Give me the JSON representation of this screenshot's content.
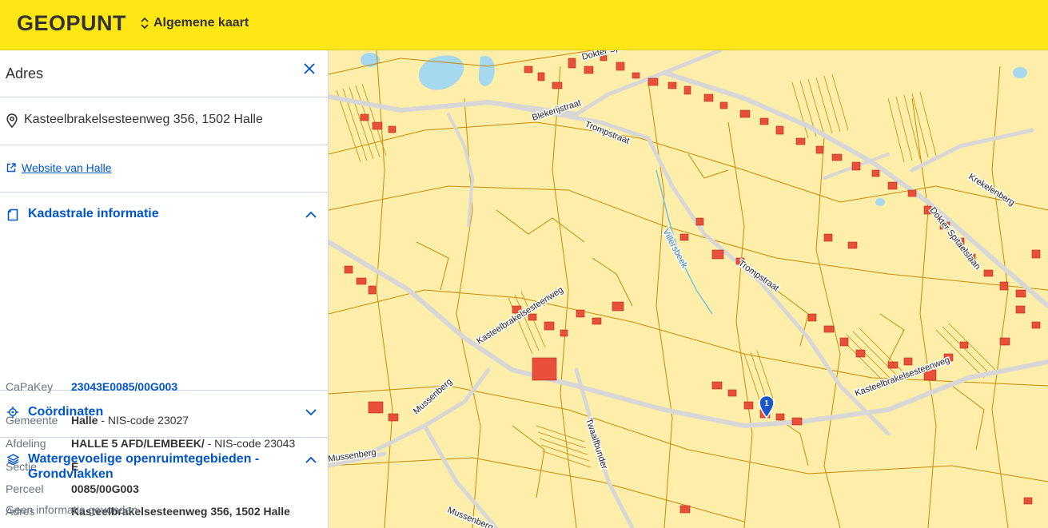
{
  "header": {
    "logo": "GEOPUNT",
    "layer_selector": "Algemene kaart"
  },
  "panel": {
    "title": "Adres",
    "address": "Kasteelbrakelsesteenweg 356, 1502 Halle",
    "website_link": "Website van Halle",
    "kadaster": {
      "title": "Kadastrale informatie",
      "capakey_label": "CaPaKey",
      "capakey_value": "23043E0085/00G003",
      "gemeente_label": "Gemeente",
      "gemeente_value": "Halle",
      "gemeente_suffix": " - NIS-code 23027",
      "afdeling_label": "Afdeling",
      "afdeling_value": "HALLE 5 AFD/LEMBEEK/",
      "afdeling_suffix": " - NIS-code 23043",
      "sectie_label": "Sectie",
      "sectie_value": "E",
      "perceel_label": "Perceel",
      "perceel_value": "0085/00G003",
      "adres_label": "Adres",
      "adres_value": "Kasteelbrakelsesteenweg 356, 1502 Halle"
    },
    "coordinaten": {
      "title": "Coördinaten"
    },
    "water": {
      "title": "Watergevoelige openruimtegebieden - Grondvlakken",
      "empty": "Geen informatie gevonden"
    }
  },
  "map": {
    "marker_label": "1",
    "streets": {
      "s1": "Dokter Spitaelslaan",
      "s2": "Blekerijstraat",
      "s3": "Trompstraat",
      "s4": "Krekelenberg",
      "s5": "Dokter Spitaelslaan",
      "s6": "Villersbeek",
      "s7": "Trompstraat",
      "s8": "Kasteelbrakelsesteenweg",
      "s9": "Kasteelbrakelsesteenweg",
      "s10": "Mussenberg",
      "s11": "Twaalfbunder",
      "s12": "Mussenberg",
      "s13": "Mussenberg"
    },
    "colors": {
      "background": "#fdeeaa",
      "parcel": "#c98a00",
      "building": "#e8503a",
      "road": "#d7d7d7",
      "water": "#a6d8f0",
      "marker": "#1a56c8"
    }
  }
}
